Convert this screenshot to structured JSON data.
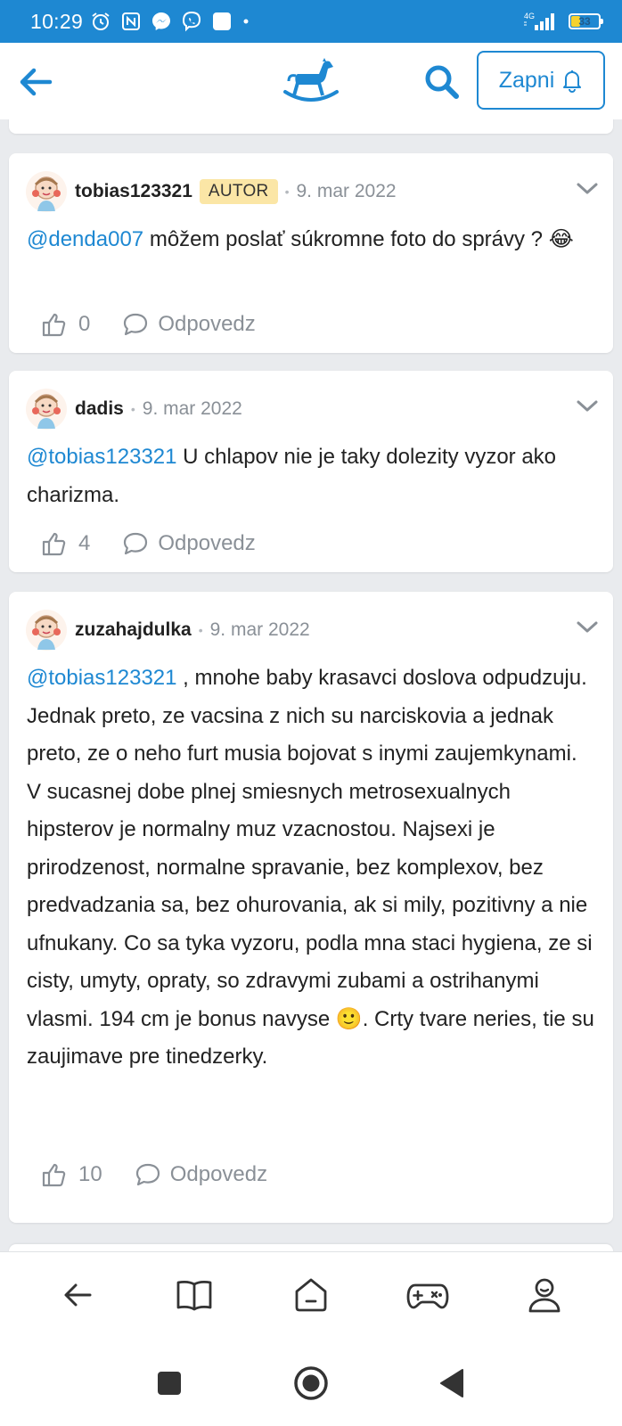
{
  "status_bar": {
    "time": "10:29",
    "network": "4G",
    "battery": "33",
    "battery_level": 0.33
  },
  "app_bar": {
    "back_icon": "arrow-left-icon",
    "logo_icon": "rocking-horse-logo",
    "search_icon": "search-icon",
    "subscribe_label": "Zapni",
    "bell_icon": "bell-icon"
  },
  "comments": [
    {
      "author": "tobias123321",
      "badge": "AUTOR",
      "date": "9. mar 2022",
      "mention": "@denda007",
      "text": " môžem poslať súkromne foto do správy ? 😂",
      "likes": "0",
      "reply_label": "Odpovedz"
    },
    {
      "author": "dadis",
      "date": "9. mar 2022",
      "mention": "@tobias123321",
      "text": " U chlapov nie je taky dolezity vyzor ako charizma.",
      "likes": "4",
      "reply_label": "Odpovedz"
    },
    {
      "author": "zuzahajdulka",
      "date": "9. mar 2022",
      "mention": "@tobias123321",
      "text": " , mnohe baby krasavci doslova odpudzuju. Jednak preto, ze vacsina z nich su narciskovia a jednak preto, ze o neho furt musia bojovat s inymi zaujemkynami. V sucasnej dobe plnej smiesnych metrosexualnych hipsterov je normalny muz vzacnostou. Najsexi je prirodzenost, normalne spravanie, bez komplexov, bez predvadzania sa, bez ohurovania, ak si mily, pozitivny a nie ufnukany. Co sa tyka vyzoru, podla mna staci hygiena, ze si cisty, umyty, opraty, so zdravymi zubami a ostrihanymi vlasmi. 194 cm je bonus navyse 🙂. Crty tvare neries, tie su zaujimave pre tinedzerky.",
      "likes": "10",
      "reply_label": "Odpovedz"
    }
  ],
  "bottom_nav": {
    "items": [
      "back-arrow-icon",
      "book-icon",
      "home-icon",
      "gamepad-icon",
      "profile-icon"
    ]
  },
  "system_nav": {
    "items": [
      "recents-square-icon",
      "home-circle-icon",
      "back-triangle-icon"
    ]
  },
  "colors": {
    "accent": "#1e88d2",
    "badge_bg": "#fbe6a6",
    "background": "#e9ebee",
    "meta_text": "#8a9097"
  }
}
